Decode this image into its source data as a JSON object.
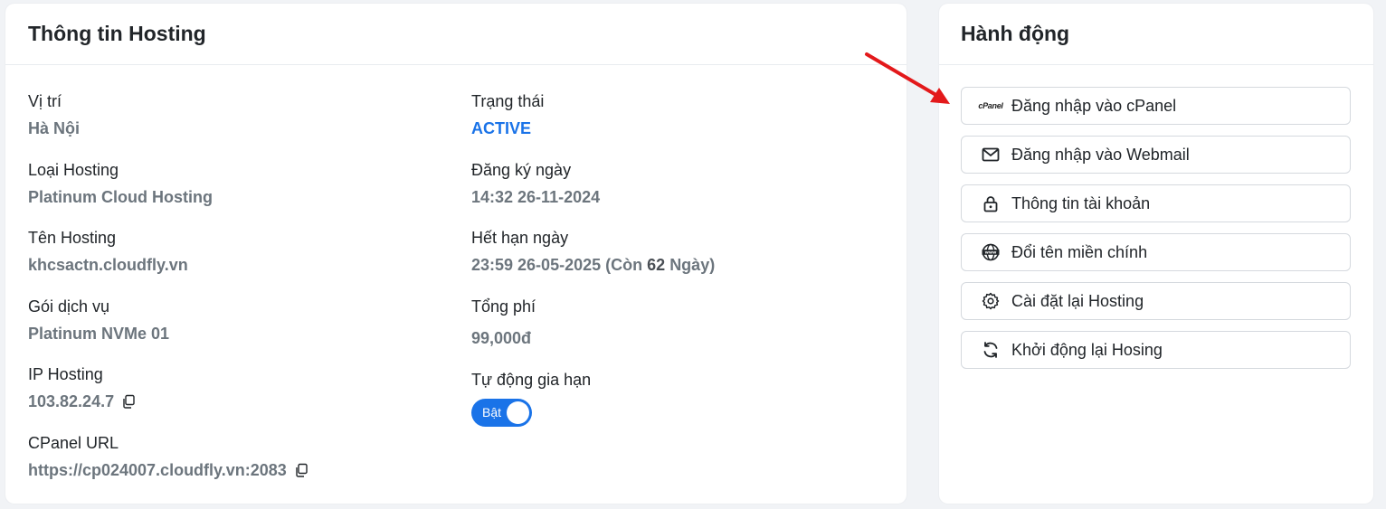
{
  "info": {
    "title": "Thông tin Hosting",
    "location": {
      "label": "Vị trí",
      "value": "Hà Nội"
    },
    "hosting_type": {
      "label": "Loại Hosting",
      "value": "Platinum Cloud Hosting"
    },
    "hosting_name": {
      "label": "Tên Hosting",
      "value": "khcsactn.cloudfly.vn"
    },
    "plan": {
      "label": "Gói dịch vụ",
      "value": "Platinum NVMe 01"
    },
    "ip": {
      "label": "IP Hosting",
      "value": "103.82.24.7"
    },
    "cpanel_url": {
      "label": "CPanel URL",
      "value": "https://cp024007.cloudfly.vn:2083"
    },
    "status": {
      "label": "Trạng thái",
      "value": "ACTIVE"
    },
    "registered": {
      "label": "Đăng ký ngày",
      "value": "14:32 26-11-2024"
    },
    "expires": {
      "label": "Hết hạn ngày",
      "value": "23:59 26-05-2025",
      "remaining_prefix": "(Còn",
      "remaining_days": "62",
      "remaining_suffix": "Ngày)"
    },
    "total_fee": {
      "label": "Tổng phí",
      "value": "99,000đ"
    },
    "auto_renew": {
      "label": "Tự động gia hạn",
      "toggle_label": "Bật",
      "enabled": true
    }
  },
  "actions": {
    "title": "Hành động",
    "cpanel_logo": "cPanel",
    "buttons": [
      {
        "label": "Đăng nhập vào cPanel",
        "icon": "cpanel-icon"
      },
      {
        "label": "Đăng nhập vào Webmail",
        "icon": "mail-icon"
      },
      {
        "label": "Thông tin tài khoản",
        "icon": "lock-icon"
      },
      {
        "label": "Đổi tên miền chính",
        "icon": "www-globe-icon"
      },
      {
        "label": "Cài đặt lại Hosting",
        "icon": "gear-icon"
      },
      {
        "label": "Khởi động lại Hosing",
        "icon": "refresh-icon"
      }
    ]
  },
  "colors": {
    "accent": "#1a73e8",
    "muted": "#6c757d",
    "arrow": "#e3191b"
  }
}
